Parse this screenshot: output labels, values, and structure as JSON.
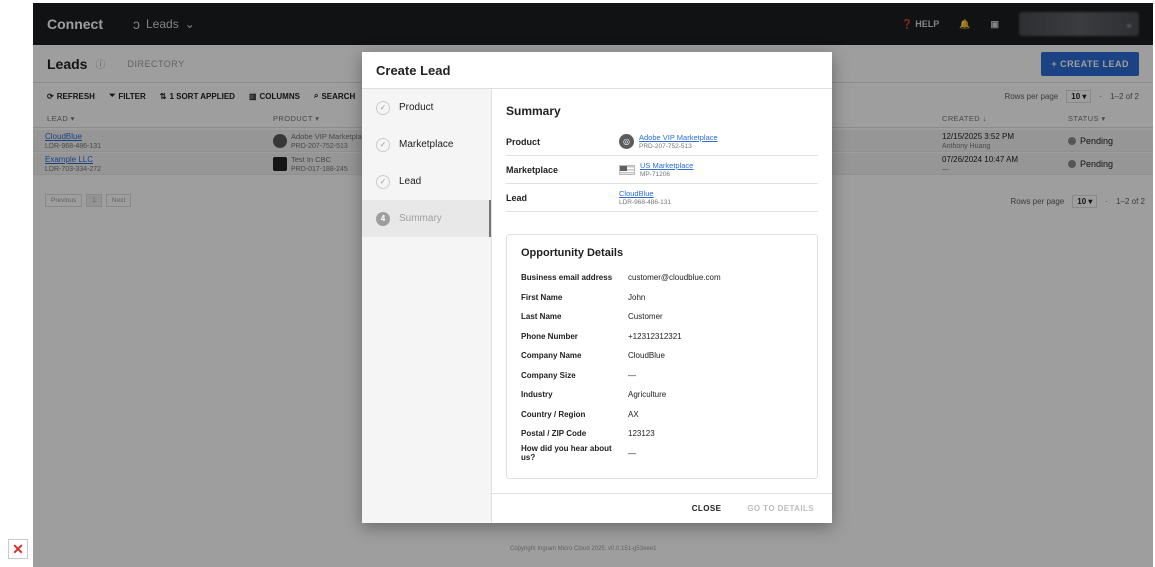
{
  "topbar": {
    "brand": "Connect",
    "module": "Leads",
    "help": "HELP"
  },
  "page": {
    "title": "Leads",
    "directory_tab": "DIRECTORY",
    "create_button": "+ CREATE LEAD"
  },
  "toolbar": {
    "refresh": "REFRESH",
    "filter": "FILTER",
    "sort": "1 SORT APPLIED",
    "columns": "COLUMNS",
    "search": "SEARCH",
    "rows_per_page_label": "Rows per page",
    "rows_per_page_value": "10",
    "range": "1–2 of 2"
  },
  "table": {
    "headers": {
      "lead": "LEAD",
      "product": "PRODUCT",
      "created": "CREATED",
      "status": "STATUS"
    },
    "rows": [
      {
        "lead": "CloudBlue",
        "lead_id": "LDR-968-486-131",
        "product": "Adobe VIP Marketplace",
        "product_id": "PRD-207-752-513",
        "created": "12/15/2025 3:52 PM",
        "created_by": "Anthony Huang",
        "status": "Pending"
      },
      {
        "lead": "Example LLC",
        "lead_id": "LDR-703-334-272",
        "product": "Test In CBC",
        "product_id": "PRD-017-188-245",
        "created": "07/26/2024 10:47 AM",
        "created_by": "—",
        "status": "Pending"
      }
    ],
    "pager": {
      "previous": "Previous",
      "page": "1",
      "next": "Next"
    }
  },
  "footer": "Copyright Ingram Micro Cloud 2025. v0.0.151-g53eee1",
  "modal": {
    "title": "Create Lead",
    "steps": [
      {
        "label": "Product",
        "state": "done"
      },
      {
        "label": "Marketplace",
        "state": "done"
      },
      {
        "label": "Lead",
        "state": "done"
      },
      {
        "label": "Summary",
        "state": "active",
        "number": "4"
      }
    ],
    "summary_title": "Summary",
    "summary": {
      "product": {
        "label": "Product",
        "name": "Adobe VIP Marketplace",
        "id": "PRD-207-752-513"
      },
      "marketplace": {
        "label": "Marketplace",
        "name": "US Marketplace",
        "id": "MP-71206"
      },
      "lead": {
        "label": "Lead",
        "name": "CloudBlue",
        "id": "LDR-968-486-131"
      }
    },
    "opportunity_title": "Opportunity Details",
    "opportunity": [
      {
        "label": "Business email address",
        "value": "customer@cloudblue.com"
      },
      {
        "label": "First Name",
        "value": "John"
      },
      {
        "label": "Last Name",
        "value": "Customer"
      },
      {
        "label": "Phone Number",
        "value": "+12312312321"
      },
      {
        "label": "Company Name",
        "value": "CloudBlue"
      },
      {
        "label": "Company Size",
        "value": "—"
      },
      {
        "label": "Industry",
        "value": "Agriculture"
      },
      {
        "label": "Country / Region",
        "value": "AX"
      },
      {
        "label": "Postal / ZIP Code",
        "value": "123123"
      },
      {
        "label": "How did you hear about us?",
        "value": "—"
      }
    ],
    "actions": {
      "close": "CLOSE",
      "go_to_details": "GO TO DETAILS"
    }
  },
  "colors": {
    "accent": "#2c6dd6",
    "topbar": "#1b1d20"
  }
}
